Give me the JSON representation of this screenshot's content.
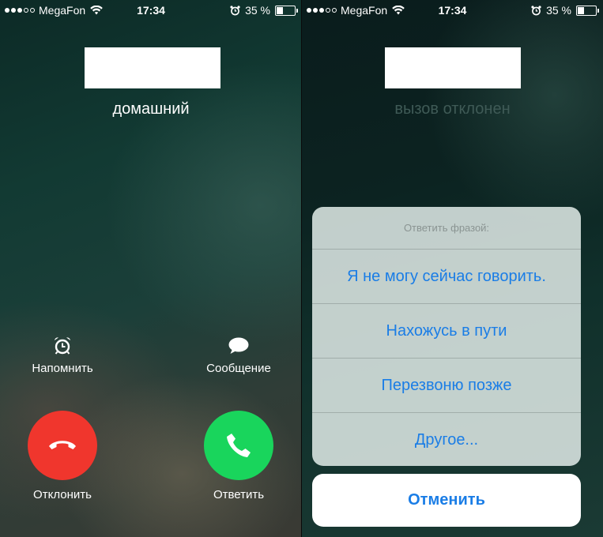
{
  "status_bar": {
    "carrier": "MegaFon",
    "time": "17:34",
    "battery_text": "35 %",
    "battery_level": 0.35,
    "signal_bars_filled": 3,
    "signal_bars_total": 5
  },
  "incoming_call": {
    "subtitle": "домашний",
    "remind_label": "Напомнить",
    "message_label": "Сообщение",
    "decline_label": "Отклонить",
    "accept_label": "Ответить",
    "decline_color": "#f0362d",
    "accept_color": "#19d55c"
  },
  "declined_screen": {
    "subtitle": "вызов отклонен",
    "sheet": {
      "title": "Ответить фразой:",
      "options": [
        "Я не могу сейчас говорить.",
        "Нахожусь в пути",
        "Перезвоню позже",
        "Другое..."
      ],
      "cancel_label": "Отменить"
    }
  },
  "icons": {
    "alarm": "alarm-clock-icon",
    "message": "speech-bubble-icon",
    "wifi": "wifi-icon",
    "decline": "phone-hangup-icon",
    "accept": "phone-icon"
  }
}
